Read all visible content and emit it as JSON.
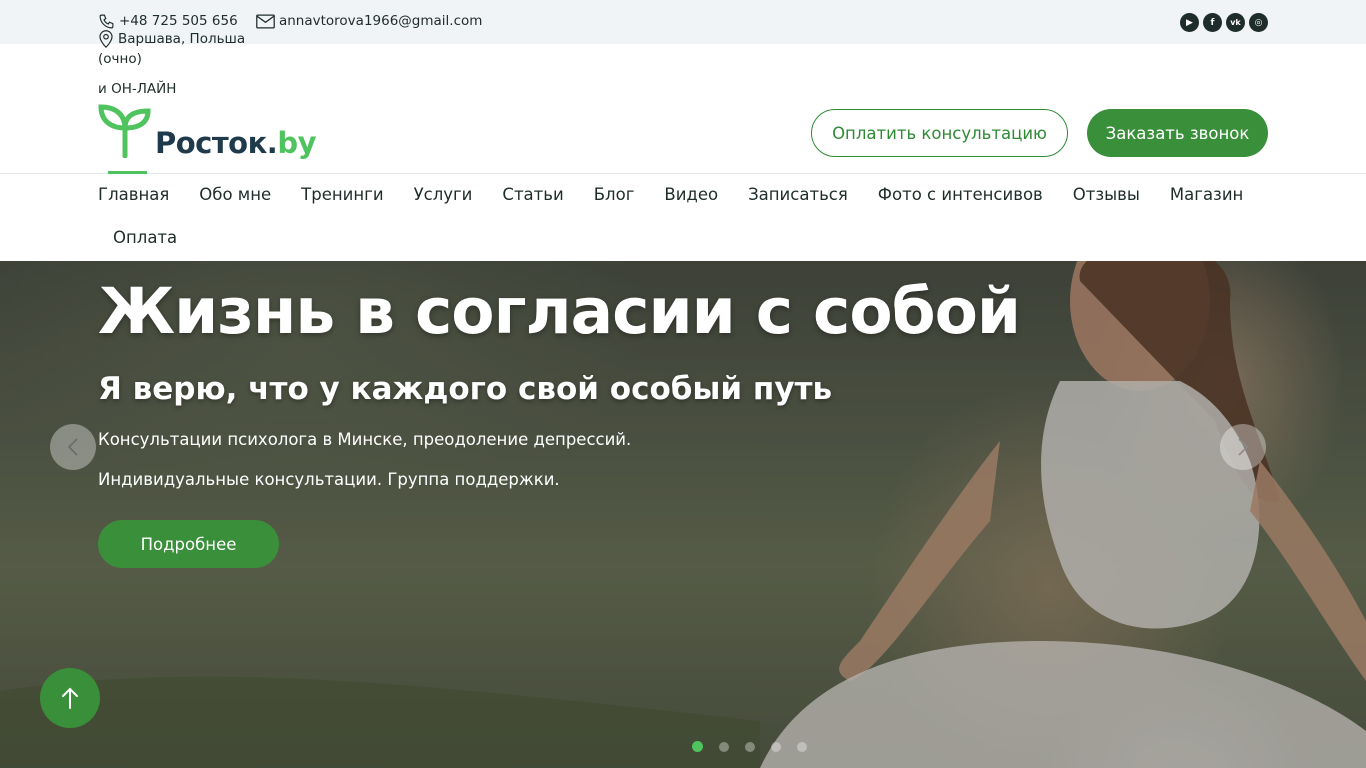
{
  "topbar": {
    "phone": "+48 725 505 656",
    "email": "annavtorova1966@gmail.com",
    "location": "Варшава, Польша",
    "location_note_1": "(очно)",
    "location_note_2": "и ОН-ЛАЙН",
    "socials": [
      {
        "name": "youtube",
        "glyph": "▶"
      },
      {
        "name": "facebook",
        "glyph": "f"
      },
      {
        "name": "vk",
        "glyph": "vk"
      },
      {
        "name": "instagram",
        "glyph": "◎"
      }
    ]
  },
  "header": {
    "logo_main": "Росток.",
    "logo_by": "by",
    "pay_button": "Оплатить консультацию",
    "call_button": "Заказать звонок"
  },
  "nav": {
    "items": [
      "Главная",
      "Обо мне",
      "Тренинги",
      "Услуги",
      "Статьи",
      "Блог",
      "Видео",
      "Записаться",
      "Фото с интенсивов",
      "Отзывы",
      "Магазин"
    ],
    "item_last": "Оплата",
    "active_index": 0
  },
  "hero": {
    "title": "Жизнь в согласии с собой",
    "subtitle": "Я верю, что у каждого свой особый путь",
    "line1": "Консультации психолога в Минске, преодоление депрессий.",
    "line2": "Индивидуальные консультации. Группа поддержки.",
    "more_button": "Подробнее",
    "slides_count": 5,
    "active_slide": 0
  },
  "colors": {
    "brand_green": "#3a8f3a",
    "accent_green": "#4fc35d",
    "dark_text": "#1f2d2a"
  }
}
